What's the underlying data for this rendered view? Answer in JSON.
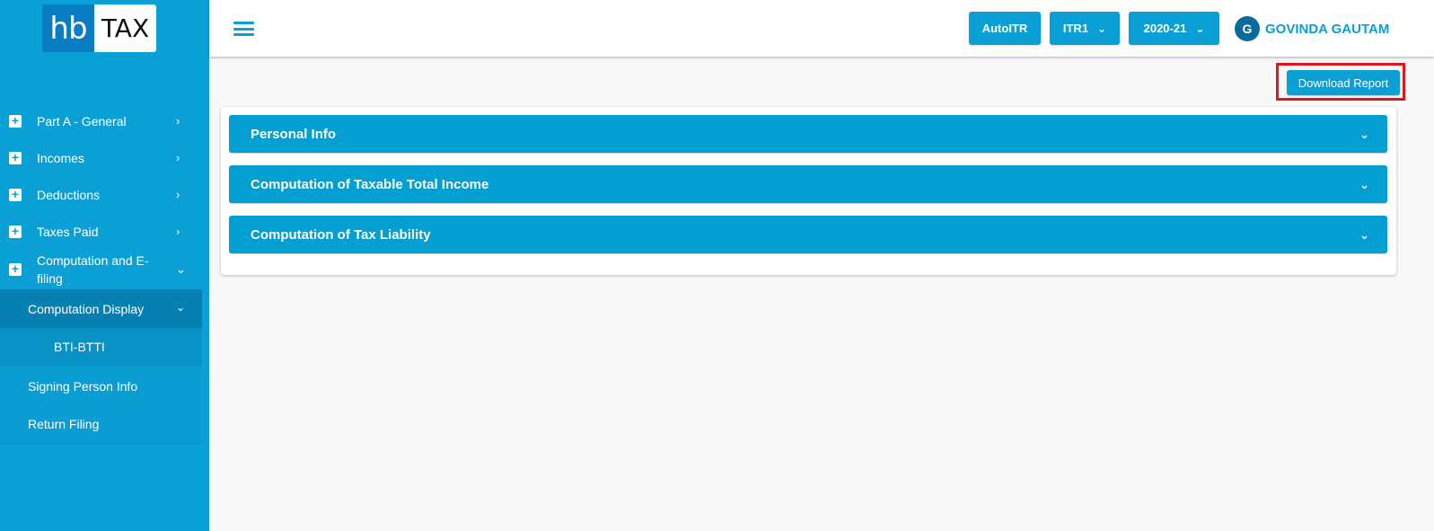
{
  "logo": {
    "left": "hb",
    "right": "TAX"
  },
  "sidebar": {
    "items": [
      {
        "label": "Part A - General",
        "icon": "plus-box-icon",
        "chevron": "chevron-right-icon"
      },
      {
        "label": "Incomes",
        "icon": "plus-box-icon",
        "chevron": "chevron-right-icon"
      },
      {
        "label": "Deductions",
        "icon": "plus-box-icon",
        "chevron": "chevron-right-icon"
      },
      {
        "label": "Taxes Paid",
        "icon": "plus-box-icon",
        "chevron": "chevron-right-icon"
      },
      {
        "label": "Computation and E-filing",
        "icon": "plus-box-icon",
        "chevron": "chevron-down-icon"
      }
    ],
    "sub_active": {
      "label": "Computation Display",
      "chevron": "chevron-down-icon"
    },
    "sub_sub": {
      "label": "BTI-BTTI"
    },
    "plain": [
      {
        "label": "Signing Person Info"
      },
      {
        "label": "Return Filing"
      }
    ]
  },
  "topbar": {
    "menu_icon": "hamburger-icon",
    "autoitr_label": "AutoITR",
    "itr_label": "ITR1",
    "year_label": "2020-21",
    "user_initial": "G",
    "user_name": "GOVINDA GAUTAM"
  },
  "main": {
    "download_label": "Download Report",
    "accordions": [
      {
        "label": "Personal Info"
      },
      {
        "label": "Computation of Taxable Total Income"
      },
      {
        "label": "Computation of Tax Liability"
      }
    ]
  },
  "colors": {
    "primary": "#0aa0d5",
    "highlight": "#e0161e",
    "avatar": "#0a6c9a",
    "logo_blue": "#0a7cc2"
  }
}
